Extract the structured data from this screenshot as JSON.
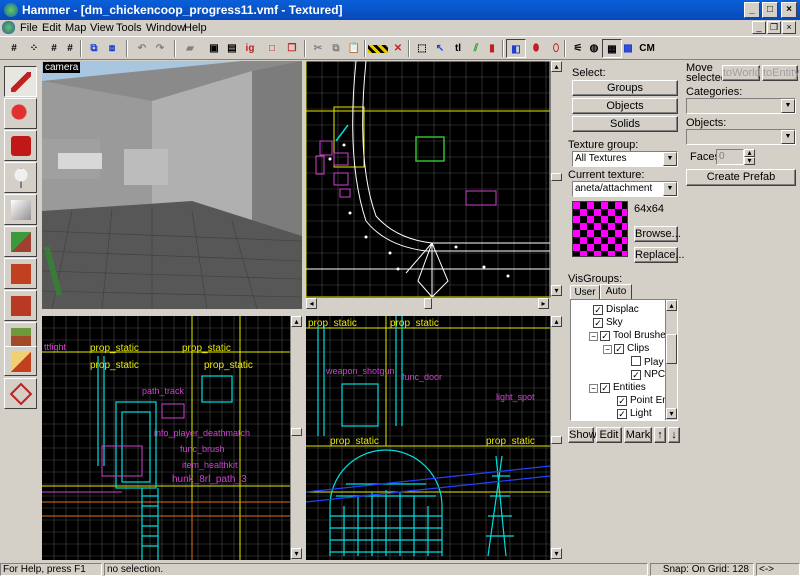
{
  "window": {
    "title": "Hammer - [dm_chickencoop_progress11.vmf - Textured]",
    "minimize": "_",
    "maximize": "□",
    "close": "×"
  },
  "menu": {
    "items": [
      "File",
      "Edit",
      "Map",
      "View",
      "Tools",
      "Window",
      "Help"
    ],
    "doc_min": "_",
    "doc_restore": "❐",
    "doc_close": "×"
  },
  "toolbar": {
    "icons": [
      "grid-toggle-icon",
      "grid-dots-icon",
      "grid-smaller-icon",
      "grid-larger-icon",
      "group-icon",
      "ungroup-icon",
      "undo-icon",
      "redo-icon",
      "carve-icon",
      "hollow-icon",
      "cut-icon",
      "copy-icon",
      "paste-icon",
      "dimensions-icon",
      "helper-icon",
      "selection-box-icon",
      "texture-lock-icon",
      "texture-scaling-icon",
      "ignore-groups-icon",
      "hide-icon",
      "cordon-icon",
      "3d-grid-icon",
      "wireframe-icon",
      "flat-icon",
      "textured-icon",
      "lighting-icon"
    ],
    "cm_label": "CM",
    "tl_label": "tl"
  },
  "left_tools": [
    "selection-tool-icon",
    "magnify-tool-icon",
    "camera-tool-icon",
    "entity-tool-icon",
    "block-tool-icon",
    "texture-tool-icon",
    "apply-texture-icon",
    "decal-tool-icon",
    "overlay-tool-icon",
    "clipping-tool-icon",
    "vertex-tool-icon"
  ],
  "viewports": {
    "camera_label": "camera",
    "side_labels": [
      {
        "text": "prop_static"
      },
      {
        "text": "prop_static"
      },
      {
        "text": "prop_static"
      },
      {
        "text": "prop_static"
      },
      {
        "text": "path_track"
      },
      {
        "text": "hunk_8rl_path_3"
      },
      {
        "text": "info_player_deathmatch"
      },
      {
        "text": "func_brush"
      },
      {
        "text": "item_healthkit"
      },
      {
        "text": "ttfight"
      }
    ],
    "front_labels": [
      {
        "text": "prop_static"
      },
      {
        "text": "prop_static"
      },
      {
        "text": "prop_static"
      },
      {
        "text": "prop_static"
      },
      {
        "text": "weapon_shotgun"
      },
      {
        "text": "func_door"
      },
      {
        "text": "light_spot"
      }
    ]
  },
  "select_panel": {
    "label": "Select:",
    "groups": "Groups",
    "objects": "Objects",
    "solids": "Solids"
  },
  "move_panel": {
    "label_line1": "Move",
    "label_line2": "selected:",
    "toworld": "toWorld",
    "toentity": "toEntity",
    "categories": "Categories:",
    "objects": "Objects:",
    "faces": "Faces:",
    "faces_value": "0",
    "create_prefab": "Create Prefab"
  },
  "texture_panel": {
    "group_label": "Texture group:",
    "group_value": "All Textures",
    "current_label": "Current texture:",
    "current_value": "aneta/attachment",
    "size": "64x64",
    "browse": "Browse...",
    "replace": "Replace..."
  },
  "visgroups": {
    "label": "VisGroups:",
    "tabs": [
      "User",
      "Auto"
    ],
    "active_tab": "Auto",
    "items": [
      {
        "text": "Displac",
        "indent": 2,
        "checked": true,
        "expander": ""
      },
      {
        "text": "Sky",
        "indent": 2,
        "checked": true,
        "expander": ""
      },
      {
        "text": "Tool Brushes",
        "indent": 1,
        "checked": true,
        "expander": "−"
      },
      {
        "text": "Clips",
        "indent": 2,
        "checked": true,
        "expander": "−"
      },
      {
        "text": "Play",
        "indent": 3,
        "checked": false,
        "expander": ""
      },
      {
        "text": "NPC",
        "indent": 3,
        "checked": true,
        "expander": ""
      },
      {
        "text": "Entities",
        "indent": 1,
        "checked": true,
        "expander": "−"
      },
      {
        "text": "Point En",
        "indent": 2,
        "checked": true,
        "expander": ""
      },
      {
        "text": "Light",
        "indent": 2,
        "checked": true,
        "expander": ""
      }
    ],
    "buttons": {
      "show": "Show",
      "edit": "Edit",
      "mark": "Mark",
      "up": "↑",
      "down": "↓"
    }
  },
  "status": {
    "help": "For Help, press F1",
    "selection": "no selection.",
    "snap": "Snap: On Grid: 128",
    "coords": "<->"
  },
  "colors": {
    "titlebar": "#0848b8",
    "grid": "#4a4a4a",
    "yellow": "#e8e800",
    "cyan": "#00e8e8",
    "magenta": "#e040e0",
    "brush_white": "#ffffff",
    "texture_a": "#ff00ff",
    "texture_b": "#000000"
  }
}
